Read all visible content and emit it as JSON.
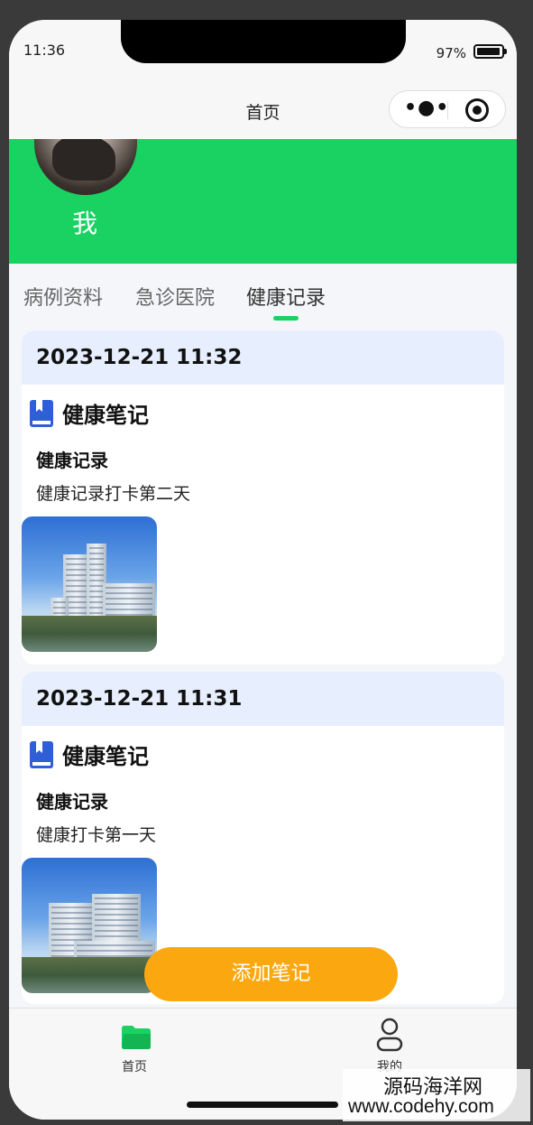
{
  "status_bar": {
    "time": "11:36",
    "battery_pct": "97%",
    "battery_level": 0.97
  },
  "nav": {
    "title": "首页",
    "capsule_more_icon": "more-dots-icon",
    "capsule_close_icon": "target-circle-icon"
  },
  "profile": {
    "name": "我",
    "avatar_icon": "user-avatar-photo"
  },
  "tabs": [
    {
      "label": "病例资料",
      "active": false
    },
    {
      "label": "急诊医院",
      "active": false
    },
    {
      "label": "健康记录",
      "active": true
    }
  ],
  "records": [
    {
      "date": "2023-12-21 11:32",
      "note_icon": "book-icon",
      "note_title": "健康笔记",
      "subtitle": "健康记录",
      "content": "健康记录打卡第二天",
      "image": "hospital-building-photo"
    },
    {
      "date": "2023-12-21 11:31",
      "note_icon": "book-icon",
      "note_title": "健康笔记",
      "subtitle": "健康记录",
      "content": "健康打卡第一天",
      "image": "hospital-building-photo"
    }
  ],
  "add_button_label": "添加笔记",
  "tab_bar": [
    {
      "label": "首页",
      "icon": "folder-icon",
      "active": true
    },
    {
      "label": "我的",
      "icon": "person-icon",
      "active": false
    }
  ],
  "watermark": {
    "cn": "源码海洋网",
    "en": "www.codehy.com"
  },
  "colors": {
    "primary_green": "#1ad262",
    "date_header_bg": "#e7effe",
    "accent_orange": "#fba810",
    "book_blue": "#2f5fd6"
  }
}
